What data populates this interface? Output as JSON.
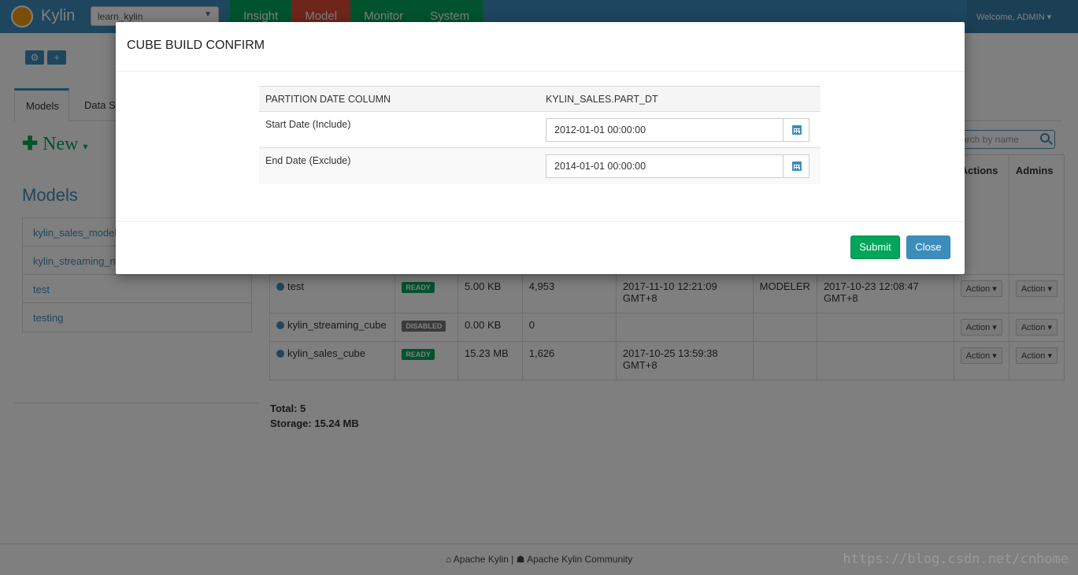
{
  "navbar": {
    "brand": "Kylin",
    "project": "learn_kylin",
    "tabs": [
      "Insight",
      "Model",
      "Monitor",
      "System"
    ],
    "welcome": "Welcome, ADMIN"
  },
  "page": {
    "sub_tabs": [
      "Models",
      "Data So"
    ],
    "new_label": "New",
    "models_heading": "Models",
    "models": [
      "kylin_sales_model",
      "kylin_streaming_m",
      "test",
      "testing"
    ],
    "search_placeholder": "arch by name",
    "table": {
      "headers": {
        "actions": "Actions",
        "admins": "Admins"
      },
      "action_label": "Action",
      "rows": [
        {
          "name": "test",
          "status": "READY",
          "size": "5.00 KB",
          "records": "4,953",
          "last_build": "2017-11-10 12:21:09 GMT+8",
          "owner": "MODELER",
          "create_time": "2017-10-23 12:08:47 GMT+8"
        },
        {
          "name": "kylin_streaming_cube",
          "status": "DISABLED",
          "size": "0.00 KB",
          "records": "0",
          "last_build": "",
          "owner": "",
          "create_time": ""
        },
        {
          "name": "kylin_sales_cube",
          "status": "READY",
          "size": "15.23 MB",
          "records": "1,626",
          "last_build": "2017-10-25 13:59:38 GMT+8",
          "owner": "",
          "create_time": ""
        }
      ]
    },
    "total": "Total: 5",
    "storage": "Storage: 15.24 MB"
  },
  "footer": {
    "link1": "Apache Kylin",
    "separator": "|",
    "link2": "Apache Kylin Community"
  },
  "watermark": "https://blog.csdn.net/cnhome",
  "modal": {
    "title": "CUBE BUILD CONFIRM",
    "partition_label": "PARTITION DATE COLUMN",
    "partition_value": "KYLIN_SALES.PART_DT",
    "start_label": "Start Date (Include)",
    "start_value": "2012-01-01 00:00:00",
    "end_label": "End Date (Exclude)",
    "end_value": "2014-01-01 00:00:00",
    "submit": "Submit",
    "close": "Close"
  },
  "colors": {
    "primary": "#3c8dbc",
    "success": "#00a65a",
    "danger": "#dd4b39"
  }
}
